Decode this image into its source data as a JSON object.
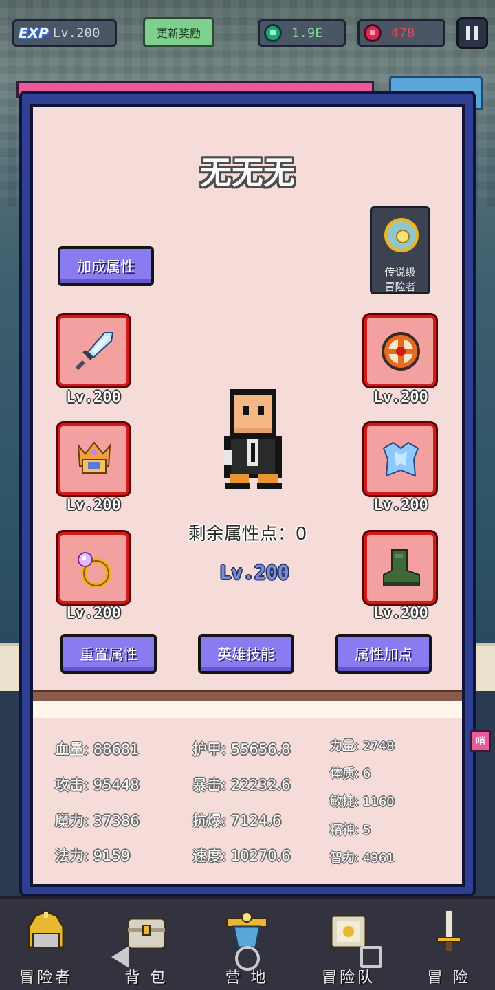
{
  "hud": {
    "exp_tag": "EXP",
    "exp_level": "Lv.200",
    "refresh_label": "更新奖励",
    "gems": "1.9E",
    "rubies": "478"
  },
  "hero": {
    "name": "无无无",
    "rank_line1": "传说级",
    "rank_line2": "冒险者",
    "remaining_points": "剩余属性点：0",
    "level": "Lv.200"
  },
  "buttons": {
    "bonus": "加成属性",
    "reset": "重置属性",
    "skills": "英雄技能",
    "points": "属性加点"
  },
  "equipment": [
    {
      "slot": "weapon",
      "icon": "sword-icon",
      "level": "Lv.200"
    },
    {
      "slot": "shield",
      "icon": "shield-icon",
      "level": "Lv.200"
    },
    {
      "slot": "helmet",
      "icon": "helmet-icon",
      "level": "Lv.200"
    },
    {
      "slot": "armor",
      "icon": "armor-icon",
      "level": "Lv.200"
    },
    {
      "slot": "ring",
      "icon": "ring-icon",
      "level": "Lv.200"
    },
    {
      "slot": "boots",
      "icon": "boots-icon",
      "level": "Lv.200"
    }
  ],
  "stats": {
    "col1": [
      "血量: 88681",
      "攻击: 95448",
      "魔力: 37386",
      "法力: 9159"
    ],
    "col2": [
      "护甲: 55656.8",
      "暴击: 22232.6",
      "抗爆: 7124.6",
      "速度: 10270.6"
    ],
    "col3": [
      "力量: 2748",
      "体质: 6",
      "敏捷: 1160",
      "精神: 5",
      "智力: 4361"
    ]
  },
  "side_tag": "哨",
  "nav": [
    {
      "label": "冒险者",
      "icon": "helmet-nav-icon"
    },
    {
      "label": "背 包",
      "icon": "chest-nav-icon"
    },
    {
      "label": "营 地",
      "icon": "camp-nav-icon"
    },
    {
      "label": "冒险队",
      "icon": "book-nav-icon"
    },
    {
      "label": "冒 险",
      "icon": "sword-nav-icon"
    }
  ],
  "colors": {
    "panel_frame": "#2f3f94",
    "panel_bg": "#f6dcd8",
    "button_purple": "#8a7cf0",
    "slot_red": "#d21a1a"
  }
}
